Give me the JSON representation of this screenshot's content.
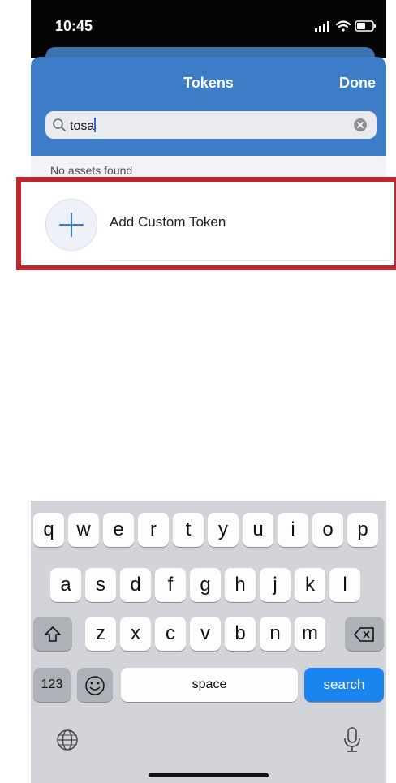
{
  "status_bar": {
    "time": "10:45"
  },
  "nav": {
    "title": "Tokens",
    "done_label": "Done"
  },
  "search": {
    "value": "tosa"
  },
  "results": {
    "empty_message": "No assets found"
  },
  "add_custom": {
    "label": "Add Custom Token"
  },
  "keyboard": {
    "row1": [
      "q",
      "w",
      "e",
      "r",
      "t",
      "y",
      "u",
      "i",
      "o",
      "p"
    ],
    "row2": [
      "a",
      "s",
      "d",
      "f",
      "g",
      "h",
      "j",
      "k",
      "l"
    ],
    "row3": [
      "z",
      "x",
      "c",
      "v",
      "b",
      "n",
      "m"
    ],
    "numbers_label": "123",
    "space_label": "space",
    "search_label": "search"
  },
  "colors": {
    "nav": "#3d7cc6",
    "highlight": "#c0262d",
    "search_key": "#1a84f0"
  }
}
